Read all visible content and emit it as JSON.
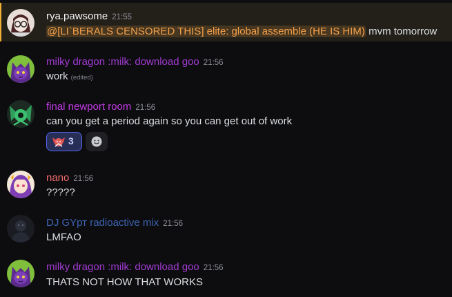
{
  "messages": [
    {
      "username": "rya.pawsome",
      "username_color": "#f2f3f5",
      "timestamp": "21:55",
      "mention": "@[LI`BERALS CENSORED THIS] elite: global assemble (HE IS HIM)",
      "text": " mvm tomorrow",
      "avatar_icon": "glasses-girl-avatar"
    },
    {
      "username": "milky dragon :milk: download goo",
      "username_color": "#a23bd2",
      "timestamp": "21:56",
      "text": "work",
      "edited_label": "(edited)",
      "avatar_icon": "purple-cat-avatar"
    },
    {
      "username": "final newport room",
      "username_color": "#c23be6",
      "timestamp": "21:56",
      "text": "can you get a period again so you can get out of work",
      "avatar_icon": "green-dark-avatar"
    },
    {
      "username": "nano",
      "username_color": "#f06a6a",
      "timestamp": "21:56",
      "text": "?????",
      "avatar_icon": "anime-girl-avatar"
    },
    {
      "username": "DJ GYрт radioactive mix",
      "username_color": "#3d63b0",
      "timestamp": "21:56",
      "text": "LMFAO",
      "avatar_icon": "dark-figure-avatar"
    },
    {
      "username": "milky dragon :milk: download goo",
      "username_color": "#a23bd2",
      "timestamp": "21:56",
      "text": "THATS NOT HOW THAT WORKS",
      "avatar_icon": "purple-cat-avatar"
    }
  ],
  "reactions": {
    "count": "3",
    "emoji_icon": "red-character-emoji",
    "add_icon": "add-reaction-smiley-icon"
  },
  "colors": {
    "background": "#0d0d10",
    "mention_highlight": "#f0b132",
    "reaction_active": "#5865f2"
  }
}
